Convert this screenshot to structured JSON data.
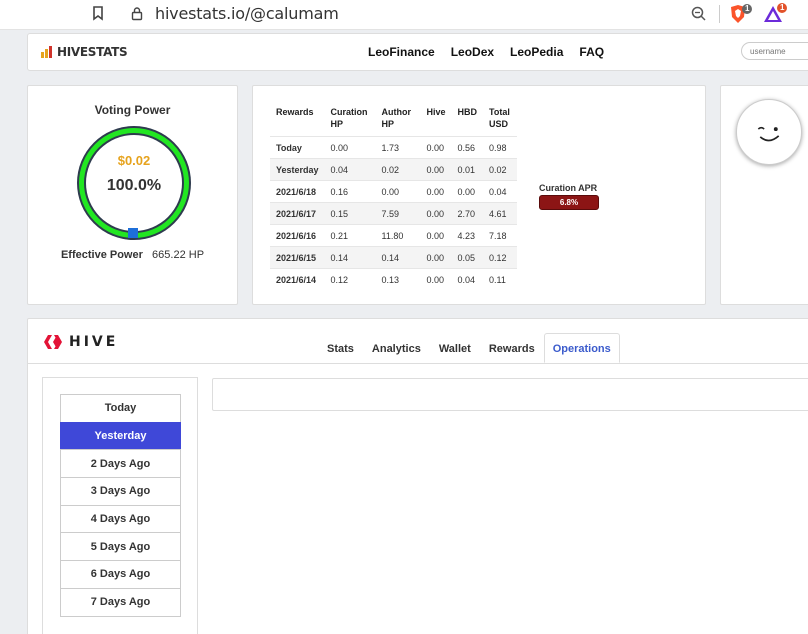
{
  "browser": {
    "url": "hivestats.io/@calumam",
    "ext_badge_1": "1",
    "ext_badge_2": "1"
  },
  "header": {
    "logo_text": "HIVESTATS",
    "nav": [
      "LeoFinance",
      "LeoDex",
      "LeoPedia",
      "FAQ"
    ],
    "username_placeholder": "username"
  },
  "voting": {
    "title": "Voting Power",
    "usd": "$0.02",
    "percent": "100.0%",
    "percent_value": 100.0,
    "effective_label": "Effective Power",
    "effective_value": "665.22 HP"
  },
  "rewards": {
    "headers": [
      "Rewards",
      "Curation HP",
      "Author HP",
      "Hive",
      "HBD",
      "Total USD"
    ],
    "rows": [
      [
        "Today",
        "0.00",
        "1.73",
        "0.00",
        "0.56",
        "0.98"
      ],
      [
        "Yesterday",
        "0.04",
        "0.02",
        "0.00",
        "0.01",
        "0.02"
      ],
      [
        "2021/6/18",
        "0.16",
        "0.00",
        "0.00",
        "0.00",
        "0.04"
      ],
      [
        "2021/6/17",
        "0.15",
        "7.59",
        "0.00",
        "2.70",
        "4.61"
      ],
      [
        "2021/6/16",
        "0.21",
        "11.80",
        "0.00",
        "4.23",
        "7.18"
      ],
      [
        "2021/6/15",
        "0.14",
        "0.14",
        "0.00",
        "0.05",
        "0.12"
      ],
      [
        "2021/6/14",
        "0.12",
        "0.13",
        "0.00",
        "0.04",
        "0.11"
      ]
    ],
    "apr_label": "Curation APR",
    "apr_value": "6.8%"
  },
  "lower": {
    "logo_text": "HIVE",
    "tabs": [
      "Stats",
      "Analytics",
      "Wallet",
      "Rewards",
      "Operations"
    ],
    "active_tab": "Operations",
    "days": [
      "Today",
      "Yesterday",
      "2 Days Ago",
      "3 Days Ago",
      "4 Days Ago",
      "5 Days Ago",
      "6 Days Ago",
      "7 Days Ago"
    ],
    "active_day": "Yesterday"
  },
  "colors": {
    "gauge_ring": "#22e622",
    "gauge_track": "#2e3b4e",
    "usd": "#e6a31e",
    "active": "#3f48d8",
    "apr_badge": "#8c1515"
  }
}
